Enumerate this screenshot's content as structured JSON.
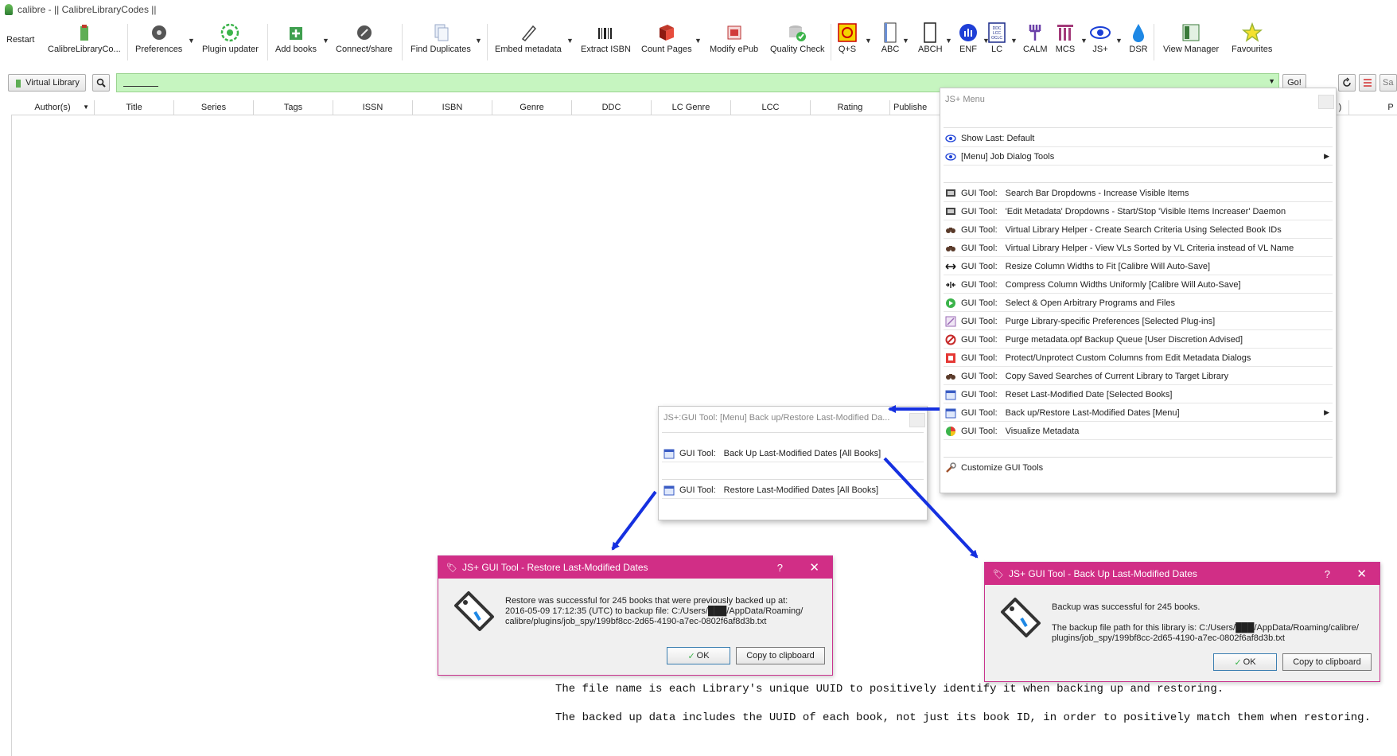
{
  "window": {
    "title": "calibre - || CalibreLibraryCodes ||"
  },
  "toolbar": {
    "restart": "Restart",
    "items": [
      {
        "label": "CalibreLibraryCo...",
        "icon": "library-icon"
      },
      {
        "label": "Preferences",
        "icon": "preferences-icon"
      },
      {
        "label": "Plugin updater",
        "icon": "plugin-updater-icon"
      },
      {
        "label": "Add books",
        "icon": "add-books-icon"
      },
      {
        "label": "Connect/share",
        "icon": "connect-share-icon"
      },
      {
        "label": "Find Duplicates",
        "icon": "find-duplicates-icon"
      },
      {
        "label": "Embed metadata",
        "icon": "embed-metadata-icon"
      },
      {
        "label": "Extract ISBN",
        "icon": "extract-isbn-icon"
      },
      {
        "label": "Count Pages",
        "icon": "count-pages-icon"
      },
      {
        "label": "Modify ePub",
        "icon": "modify-epub-icon"
      },
      {
        "label": "Quality Check",
        "icon": "quality-check-icon"
      },
      {
        "label": "Q+S",
        "icon": "qs-icon"
      },
      {
        "label": "ABC",
        "icon": "abc-icon"
      },
      {
        "label": "ABCH",
        "icon": "abch-icon"
      },
      {
        "label": "ENF",
        "icon": "enf-icon"
      },
      {
        "label": "LC",
        "icon": "lc-icon"
      },
      {
        "label": "CALM",
        "icon": "calm-icon"
      },
      {
        "label": "MCS",
        "icon": "mcs-icon"
      },
      {
        "label": "JS+",
        "icon": "jsplus-eye-icon"
      },
      {
        "label": "DSR",
        "icon": "dsr-drop-icon"
      },
      {
        "label": "View Manager",
        "icon": "view-manager-icon"
      },
      {
        "label": "Favourites",
        "icon": "favourites-star-icon"
      }
    ]
  },
  "search": {
    "virtual_library": "Virtual Library",
    "go": "Go!",
    "saved_search_placeholder": "Sa"
  },
  "columns": [
    "Author(s)",
    "Title",
    "Series",
    "Tags",
    "ISSN",
    "ISBN",
    "Genre",
    "DDC",
    "LC Genre",
    "LCC",
    "Rating",
    "Publishe",
    ")",
    "P"
  ],
  "jsmenu": {
    "title": "JS+ Menu",
    "top_items": [
      {
        "label": "Show Last: Default",
        "icon": "eye-icon"
      },
      {
        "label": "[Menu] Job Dialog Tools",
        "icon": "eye-icon"
      }
    ],
    "prefix": "GUI Tool:",
    "items": [
      {
        "label": "Search Bar Dropdowns - Increase Visible Items",
        "icon": "monitor-icon"
      },
      {
        "label": "'Edit Metadata' Dropdowns - Start/Stop 'Visible Items Increaser' Daemon",
        "icon": "monitor-icon"
      },
      {
        "label": "Virtual Library Helper - Create Search Criteria Using Selected Book IDs",
        "icon": "binoculars-icon"
      },
      {
        "label": "Virtual Library Helper - View VLs Sorted by VL Criteria instead of VL Name",
        "icon": "binoculars-icon"
      },
      {
        "label": "Resize Column Widths to Fit [Calibre Will Auto-Save]",
        "icon": "resize-arrows-icon"
      },
      {
        "label": "Compress Column Widths Uniformly [Calibre Will Auto-Save]",
        "icon": "compress-arrows-icon"
      },
      {
        "label": "Select & Open Arbitrary Programs and Files",
        "icon": "green-play-icon"
      },
      {
        "label": "Purge Library-specific Preferences [Selected Plug-ins]",
        "icon": "purge-icon"
      },
      {
        "label": "Purge metadata.opf Backup Queue [User Discretion Advised]",
        "icon": "no-entry-icon"
      },
      {
        "label": "Protect/Unprotect Custom Columns from Edit Metadata Dialogs",
        "icon": "protect-icon"
      },
      {
        "label": "Copy Saved Searches of Current Library to Target Library",
        "icon": "binoculars-icon"
      },
      {
        "label": "Reset Last-Modified Date [Selected Books]",
        "icon": "calendar-icon"
      },
      {
        "label": "Back up/Restore Last-Modified Dates [Menu]",
        "icon": "calendar-icon"
      },
      {
        "label": "Visualize Metadata",
        "icon": "pie-chart-icon"
      }
    ],
    "customize": "Customize GUI Tools"
  },
  "submenu": {
    "title": "JS+:GUI Tool:   [Menu] Back up/Restore Last-Modified Da...",
    "prefix": "GUI Tool:",
    "items": [
      "Back Up Last-Modified Dates [All Books]",
      "Restore Last-Modified Dates [All Books]"
    ]
  },
  "restore_dialog": {
    "title": "JS+ GUI Tool - Restore Last-Modified Dates",
    "message": "Restore was successful for 245 books that were previously backed up at:\n2016-05-09 17:12:35 (UTC) to backup file: C:/Users/███/AppData/Roaming/\ncalibre/plugins/job_spy/199bf8cc-2d65-4190-a7ec-0802f6af8d3b.txt",
    "ok": "OK",
    "copy": "Copy to clipboard",
    "help": "?",
    "close": "✕"
  },
  "backup_dialog": {
    "title": "JS+ GUI Tool - Back Up Last-Modified Dates",
    "message": "Backup was successful for 245 books.\n\nThe backup file path for this library is: C:/Users/███/AppData/Roaming/calibre/\nplugins/job_spy/199bf8cc-2d65-4190-a7ec-0802f6af8d3b.txt",
    "ok": "OK",
    "copy": "Copy to clipboard",
    "help": "?",
    "close": "✕"
  },
  "captions": [
    "The file name is each Library's unique UUID to positively identify it when backing up and restoring.",
    "The backed up data includes the UUID of each book, not just its book ID, in order to positively match them when restoring."
  ],
  "colors": {
    "dialog_title": "#d12e86",
    "search_bg": "#c6f5c0",
    "arrow": "#1530e0"
  }
}
